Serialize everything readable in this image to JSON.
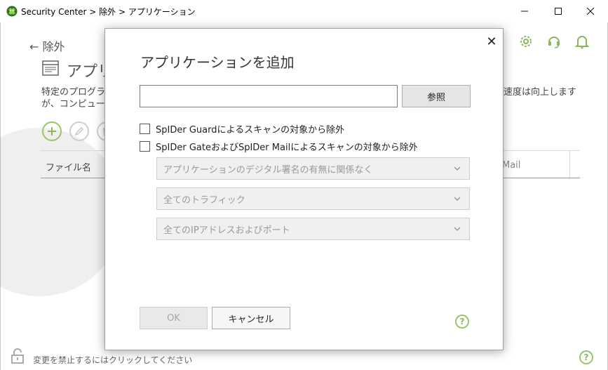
{
  "window": {
    "title": "Security Center > 除外 > アプリケーション",
    "minimize_icon": "minimize-icon",
    "maximize_icon": "maximize-icon",
    "close_icon": "close-icon"
  },
  "page": {
    "back_label": "除外",
    "title": "アプリ",
    "description_line1": "特定のプログラム",
    "description_line2": "が、コンピューター",
    "description_right": "速度は向上します",
    "header_icons": [
      "gear-icon",
      "headset-icon",
      "bell-icon"
    ]
  },
  "toolbar": {
    "add_icon": "plus-icon",
    "edit_icon": "pencil-icon",
    "delete_icon": "trash-icon"
  },
  "table": {
    "columns": [
      "ファイル名",
      "Mail"
    ]
  },
  "status": {
    "lock_text": "変更を禁止するにはクリックしてください",
    "help_glyph": "?"
  },
  "dialog": {
    "title": "アプリケーションを追加",
    "close_glyph": "✕",
    "path_value": "",
    "browse_label": "参照",
    "checkbox_guard": {
      "label": "SpIDer Guardによるスキャンの対象から除外",
      "checked": false
    },
    "checkbox_gate_mail": {
      "label": "SpIDer GateおよびSpIDer Mailによるスキャンの対象から除外",
      "checked": false
    },
    "select_signature": "アプリケーションのデジタル署名の有無に関係なく",
    "select_traffic": "全てのトラフィック",
    "select_ip": "全てのIPアドレスおよびポート",
    "ok_label": "OK",
    "cancel_label": "キャンセル",
    "help_glyph": "?"
  },
  "colors": {
    "accent": "#8ab85a",
    "disabled_text": "#a8a8a8"
  }
}
